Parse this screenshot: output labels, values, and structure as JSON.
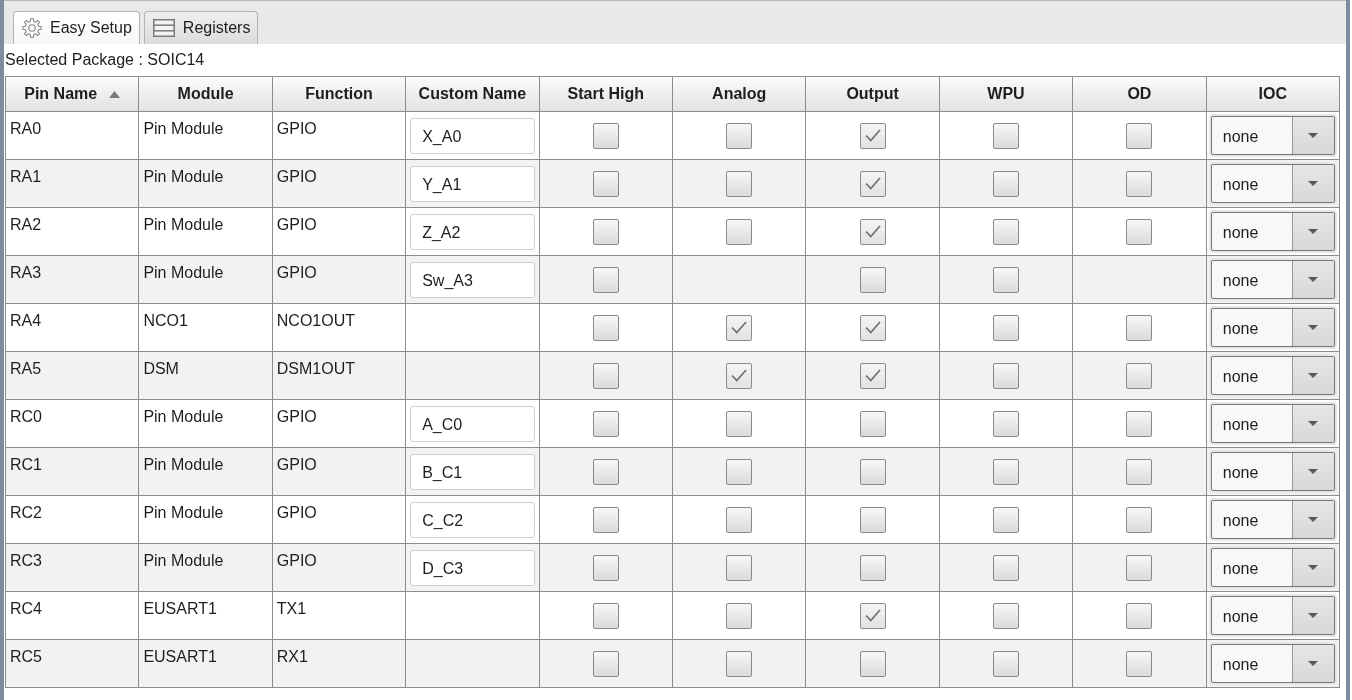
{
  "tabs": [
    {
      "label": "Easy Setup",
      "selected": true
    },
    {
      "label": "Registers",
      "selected": false
    }
  ],
  "selected_package": "Selected Package : SOIC14",
  "table": {
    "columns": [
      {
        "label": "Pin Name",
        "sorted": true
      },
      {
        "label": "Module",
        "sorted": false
      },
      {
        "label": "Function",
        "sorted": false
      },
      {
        "label": "Custom Name",
        "sorted": false
      },
      {
        "label": "Start High",
        "sorted": false
      },
      {
        "label": "Analog",
        "sorted": false
      },
      {
        "label": "Output",
        "sorted": false
      },
      {
        "label": "WPU",
        "sorted": false
      },
      {
        "label": "OD",
        "sorted": false
      },
      {
        "label": "IOC",
        "sorted": false
      }
    ],
    "rows": [
      {
        "pin_name": "RA0",
        "module": "Pin Module",
        "function": "GPIO",
        "custom_name": "X_A0",
        "start_high": false,
        "analog": false,
        "output": true,
        "wpu": false,
        "od": false,
        "ioc": "none"
      },
      {
        "pin_name": "RA1",
        "module": "Pin Module",
        "function": "GPIO",
        "custom_name": "Y_A1",
        "start_high": false,
        "analog": false,
        "output": true,
        "wpu": false,
        "od": false,
        "ioc": "none"
      },
      {
        "pin_name": "RA2",
        "module": "Pin Module",
        "function": "GPIO",
        "custom_name": "Z_A2",
        "start_high": false,
        "analog": false,
        "output": true,
        "wpu": false,
        "od": false,
        "ioc": "none"
      },
      {
        "pin_name": "RA3",
        "module": "Pin Module",
        "function": "GPIO",
        "custom_name": "Sw_A3",
        "start_high": false,
        "output": false,
        "wpu": false,
        "ioc": "none"
      },
      {
        "pin_name": "RA4",
        "module": "NCO1",
        "function": "NCO1OUT",
        "start_high": false,
        "analog": true,
        "output": true,
        "wpu": false,
        "od": false,
        "ioc": "none"
      },
      {
        "pin_name": "RA5",
        "module": "DSM",
        "function": "DSM1OUT",
        "start_high": false,
        "analog": true,
        "output": true,
        "wpu": false,
        "od": false,
        "ioc": "none"
      },
      {
        "pin_name": "RC0",
        "module": "Pin Module",
        "function": "GPIO",
        "custom_name": "A_C0",
        "start_high": false,
        "analog": false,
        "output": false,
        "wpu": false,
        "od": false,
        "ioc": "none"
      },
      {
        "pin_name": "RC1",
        "module": "Pin Module",
        "function": "GPIO",
        "custom_name": "B_C1",
        "start_high": false,
        "analog": false,
        "output": false,
        "wpu": false,
        "od": false,
        "ioc": "none"
      },
      {
        "pin_name": "RC2",
        "module": "Pin Module",
        "function": "GPIO",
        "custom_name": "C_C2",
        "start_high": false,
        "analog": false,
        "output": false,
        "wpu": false,
        "od": false,
        "ioc": "none"
      },
      {
        "pin_name": "RC3",
        "module": "Pin Module",
        "function": "GPIO",
        "custom_name": "D_C3",
        "start_high": false,
        "analog": false,
        "output": false,
        "wpu": false,
        "od": false,
        "ioc": "none"
      },
      {
        "pin_name": "RC4",
        "module": "EUSART1",
        "function": "TX1",
        "start_high": false,
        "analog": false,
        "output": true,
        "wpu": false,
        "od": false,
        "ioc": "none"
      },
      {
        "pin_name": "RC5",
        "module": "EUSART1",
        "function": "RX1",
        "start_high": false,
        "analog": false,
        "output": false,
        "wpu": false,
        "od": false,
        "ioc": "none"
      }
    ]
  }
}
